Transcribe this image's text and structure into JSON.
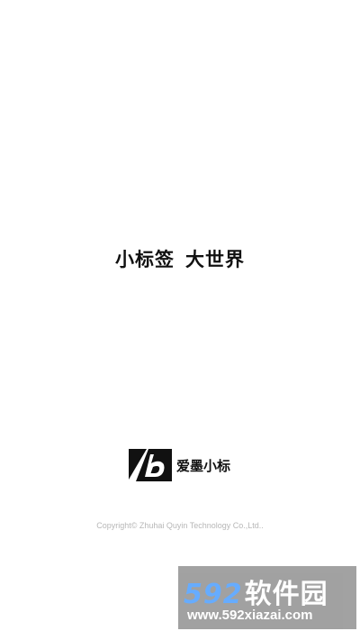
{
  "splash": {
    "slogan_part1": "小标签",
    "slogan_part2": "大世界",
    "brand_name": "爱墨小标",
    "copyright": "Copyright© Zhuhai Quyin Technology Co.,Ltd.."
  },
  "watermark": {
    "number": "592",
    "name": "软件园",
    "url": "www.592xiazai.com"
  },
  "colors": {
    "background": "#ffffff",
    "text": "#111111",
    "copyright": "#b7b7b7",
    "watermark_bg": "#9a9a9a",
    "watermark_accent": "#5aa6ff"
  },
  "icons": {
    "brand_logo": "aimo-logo-icon"
  }
}
